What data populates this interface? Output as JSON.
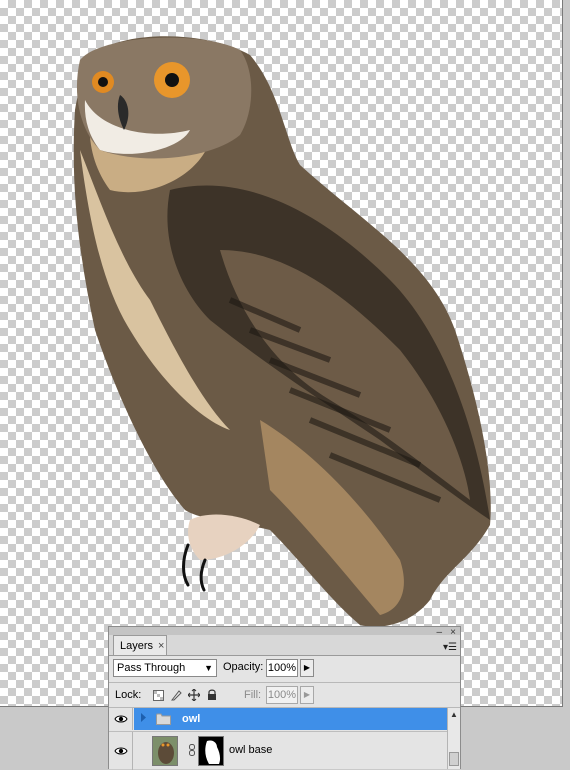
{
  "layers_panel": {
    "tab_label": "Layers",
    "tab_close": "×",
    "panel_minimize": "–",
    "panel_close": "×",
    "flyout_glyph": "▾☰",
    "blend_mode": "Pass Through",
    "opacity_label": "Opacity:",
    "opacity_value": "100%",
    "lock_label": "Lock:",
    "fill_label": "Fill:",
    "fill_value": "100%",
    "layers": [
      {
        "name": "owl",
        "type": "group",
        "selected": true,
        "visible": true
      },
      {
        "name": "owl base",
        "type": "layer",
        "selected": false,
        "visible": true,
        "has_mask": true
      }
    ]
  },
  "colors": {
    "selection": "#3f8fe8",
    "panel_bg": "#e4e4e4",
    "checker_dark": "#cccccc"
  },
  "icons": [
    "eye-icon",
    "folder-icon",
    "expand-arrow-icon",
    "chain-link-icon",
    "lock-transparent-icon",
    "lock-paint-icon",
    "lock-move-icon",
    "lock-all-icon",
    "dropdown-arrow-icon",
    "slider-arrow-icon",
    "scroll-up-icon"
  ]
}
